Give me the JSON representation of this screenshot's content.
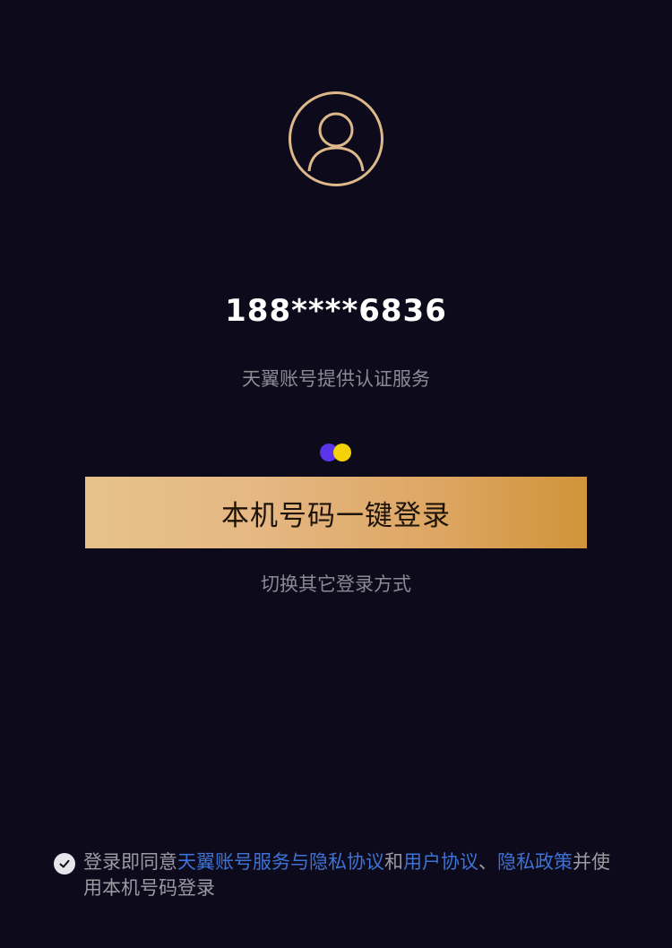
{
  "account": {
    "phone_masked": "188****6836",
    "provider_text": "天翼账号提供认证服务"
  },
  "actions": {
    "login_label": "本机号码一键登录",
    "switch_label": "切换其它登录方式"
  },
  "agreement": {
    "checked": true,
    "prefix": "登录即同意",
    "link1": "天翼账号服务与隐私协议",
    "middle": "和",
    "link2": "用户协议",
    "separator": "、",
    "link3": "隐私政策",
    "suffix": "并使用本机号码登录"
  },
  "icons": {
    "avatar": "user-avatar-icon",
    "logo": "two-dot-logo-icon",
    "check": "check-icon"
  },
  "colors": {
    "background": "#0c0a1b",
    "accent_gold": "#dcb88a",
    "link_blue": "#3d73d6",
    "muted_text": "#8b8a93",
    "logo_purple": "#5a34e8",
    "logo_yellow": "#f3d20a"
  }
}
